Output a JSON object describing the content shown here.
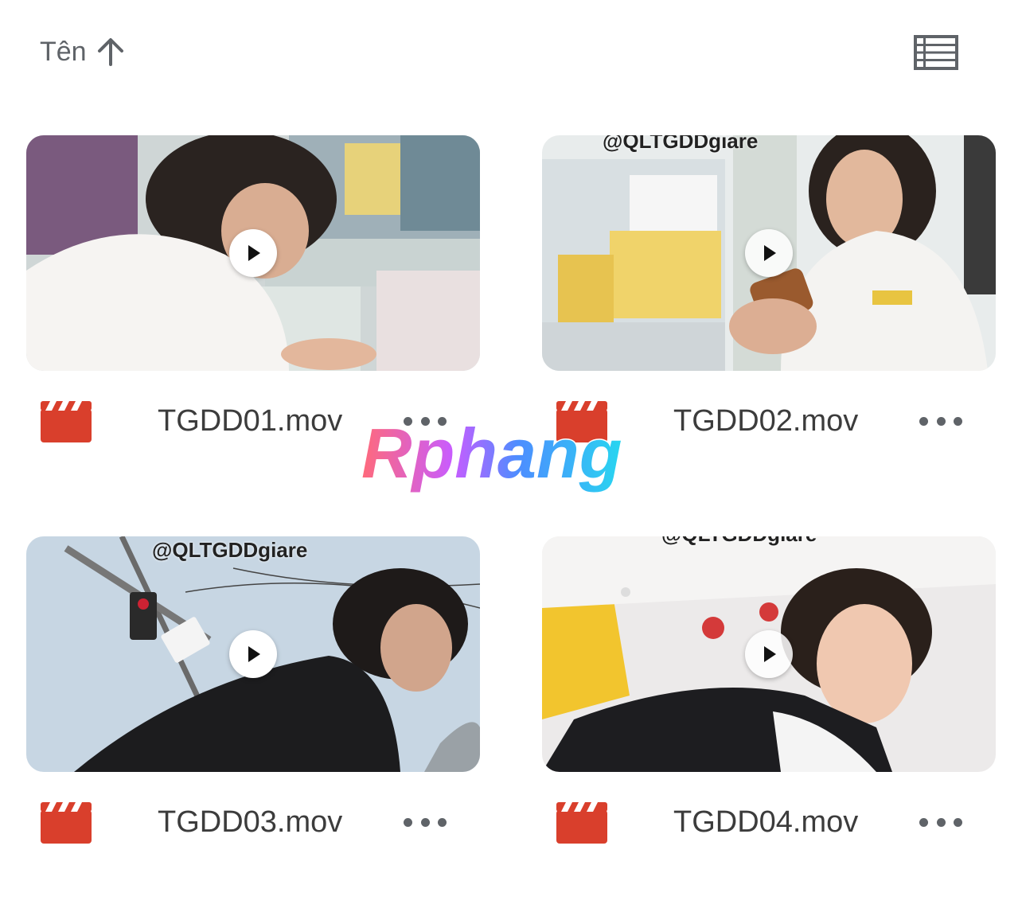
{
  "header": {
    "sort_label": "Tên",
    "sort_icon": "arrow-up-icon",
    "view_toggle_icon": "list-view-icon"
  },
  "files": [
    {
      "name": "TGDD01.mov",
      "icon": "video-file-icon",
      "overlay_text": ""
    },
    {
      "name": "TGDD02.mov",
      "icon": "video-file-icon",
      "overlay_text": "@QLTGDDgiare"
    },
    {
      "name": "TGDD03.mov",
      "icon": "video-file-icon",
      "overlay_text": "@QLTGDDgiare"
    },
    {
      "name": "TGDD04.mov",
      "icon": "video-file-icon",
      "overlay_text": "@QLTGDDgiare"
    }
  ],
  "watermark": {
    "text": "Rphang"
  },
  "colors": {
    "file_icon": "#d93f2c",
    "text": "#3c3c3c",
    "secondary": "#5f6368"
  }
}
